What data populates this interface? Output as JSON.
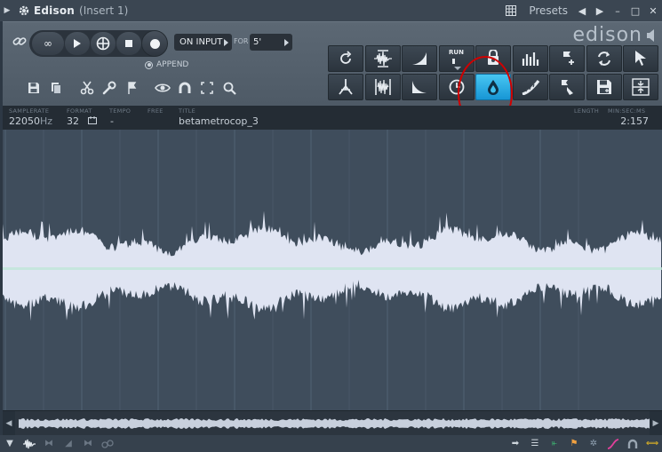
{
  "window": {
    "title": "Edison",
    "subtitle": "(Insert 1)",
    "presets_label": "Presets"
  },
  "toolbar": {
    "loop_label": "∞",
    "source_label": "ON INPUT",
    "for_label": "FOR",
    "for_value": "5'",
    "append_label": "APPEND",
    "logo_text": "edison",
    "run_label": "RUN"
  },
  "info": {
    "samplerate_label": "SAMPLERATE",
    "samplerate_value": "22050",
    "samplerate_unit": "Hz",
    "format_label": "FORMAT",
    "format_value": "32",
    "tempo_label": "TEMPO",
    "tempo_value": "-",
    "free_label": "FREE",
    "title_label": "TITLE",
    "title_value": "betametrocop_3",
    "length_label": "LENGTH",
    "time_label": "MIN:SEC:MS",
    "length_value": "2:157"
  },
  "colors": {
    "accent": "#1fa8e6",
    "waveform": "#dfe4f2",
    "waveform_bg": "#3f4d5c",
    "annotation": "#d00000",
    "centerline": "#bfe6d8"
  },
  "tools_row1": [
    "loop-icon",
    "normalize-icon",
    "fade-in-icon",
    "run-icon",
    "blur-icon",
    "equalize-icon",
    "marker-add-icon",
    "convert-icon",
    "cursor-icon"
  ],
  "tools_row2": [
    "declick-icon",
    "trim-icon",
    "fade-out-icon",
    "clock-icon",
    "drop-icon",
    "spectral-icon",
    "marker-tag-icon",
    "save-icon",
    "insert-icon"
  ]
}
